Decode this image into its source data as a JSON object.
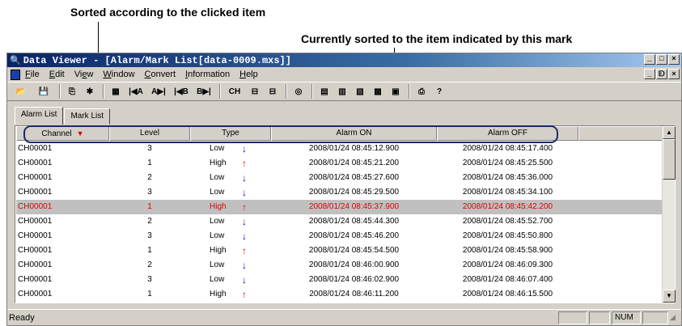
{
  "annotations": {
    "sorted_by_clicked": "Sorted according to the clicked item",
    "sort_mark": "Currently sorted to the item indicated by this mark"
  },
  "window": {
    "title": "Data Viewer - [Alarm/Mark List[data-0009.mxs]]",
    "min": "_",
    "max": "□",
    "close": "×",
    "restore": "ᗟ"
  },
  "menu": {
    "items": [
      {
        "pre": "",
        "u": "F",
        "post": "ile"
      },
      {
        "pre": "",
        "u": "E",
        "post": "dit"
      },
      {
        "pre": "Vi",
        "u": "e",
        "post": "w"
      },
      {
        "pre": "",
        "u": "W",
        "post": "indow"
      },
      {
        "pre": "",
        "u": "C",
        "post": "onvert"
      },
      {
        "pre": "",
        "u": "I",
        "post": "nformation"
      },
      {
        "pre": "",
        "u": "H",
        "post": "elp"
      }
    ]
  },
  "toolbar": {
    "buttons": [
      {
        "name": "open-icon",
        "glyph": "📂"
      },
      {
        "name": "save-icon",
        "glyph": "💾"
      },
      {
        "sep": true
      },
      {
        "name": "copy-icon",
        "glyph": "⎘"
      },
      {
        "name": "cursor-icon",
        "glyph": "✱"
      },
      {
        "sep": true
      },
      {
        "name": "grid-icon",
        "glyph": "▦"
      },
      {
        "name": "jump-a-left-icon",
        "glyph": "|◀A"
      },
      {
        "name": "jump-a-right-icon",
        "glyph": "A▶|"
      },
      {
        "name": "jump-b-left-icon",
        "glyph": "|◀B"
      },
      {
        "name": "jump-b-right-icon",
        "glyph": "B▶|"
      },
      {
        "sep": true
      },
      {
        "name": "channel-icon",
        "glyph": "CH"
      },
      {
        "name": "mark-icon",
        "glyph": "⊟"
      },
      {
        "name": "alarm-icon",
        "glyph": "⊟"
      },
      {
        "sep": true
      },
      {
        "name": "circle-icon",
        "glyph": "◎"
      },
      {
        "sep": true
      },
      {
        "name": "table-icon",
        "glyph": "▤"
      },
      {
        "name": "list-icon",
        "glyph": "▥"
      },
      {
        "name": "chart-icon",
        "glyph": "▧"
      },
      {
        "name": "display-icon",
        "glyph": "▩"
      },
      {
        "name": "info-icon",
        "glyph": "▣"
      },
      {
        "sep": true
      },
      {
        "name": "print-icon",
        "glyph": "⎙"
      },
      {
        "name": "help-icon",
        "glyph": "?"
      }
    ]
  },
  "tabs": [
    {
      "label": "Alarm List",
      "active": true
    },
    {
      "label": "Mark List",
      "active": false
    }
  ],
  "columns": {
    "channel": "Channel",
    "level": "Level",
    "type": "Type",
    "alarm_on": "Alarm ON",
    "alarm_off": "Alarm OFF",
    "sort_mark": "▼"
  },
  "rows": [
    {
      "channel": "CH00001",
      "level": "3",
      "type": "Low",
      "dir": "down",
      "on": "2008/01/24 08:45:12.900",
      "off": "2008/01/24 08:45:17.400",
      "selected": false
    },
    {
      "channel": "CH00001",
      "level": "1",
      "type": "High",
      "dir": "up",
      "on": "2008/01/24 08:45:21.200",
      "off": "2008/01/24 08:45:25.500",
      "selected": false
    },
    {
      "channel": "CH00001",
      "level": "2",
      "type": "Low",
      "dir": "down",
      "on": "2008/01/24 08:45:27.600",
      "off": "2008/01/24 08:45:36.000",
      "selected": false
    },
    {
      "channel": "CH00001",
      "level": "3",
      "type": "Low",
      "dir": "down",
      "on": "2008/01/24 08:45:29.500",
      "off": "2008/01/24 08:45:34.100",
      "selected": false
    },
    {
      "channel": "CH00001",
      "level": "1",
      "type": "High",
      "dir": "up",
      "on": "2008/01/24 08:45:37.900",
      "off": "2008/01/24 08:45:42.200",
      "selected": true
    },
    {
      "channel": "CH00001",
      "level": "2",
      "type": "Low",
      "dir": "down",
      "on": "2008/01/24 08:45:44.300",
      "off": "2008/01/24 08:45:52.700",
      "selected": false
    },
    {
      "channel": "CH00001",
      "level": "3",
      "type": "Low",
      "dir": "down",
      "on": "2008/01/24 08:45:46.200",
      "off": "2008/01/24 08:45:50.800",
      "selected": false
    },
    {
      "channel": "CH00001",
      "level": "1",
      "type": "High",
      "dir": "up",
      "on": "2008/01/24 08:45:54.500",
      "off": "2008/01/24 08:45:58.900",
      "selected": false
    },
    {
      "channel": "CH00001",
      "level": "2",
      "type": "Low",
      "dir": "down",
      "on": "2008/01/24 08:46:00.900",
      "off": "2008/01/24 08:46:09.300",
      "selected": false
    },
    {
      "channel": "CH00001",
      "level": "3",
      "type": "Low",
      "dir": "down",
      "on": "2008/01/24 08:46:02.900",
      "off": "2008/01/24 08:46:07.400",
      "selected": false
    },
    {
      "channel": "CH00001",
      "level": "1",
      "type": "High",
      "dir": "up",
      "on": "2008/01/24 08:46:11.200",
      "off": "2008/01/24 08:46:15.500",
      "selected": false
    }
  ],
  "scroll": {
    "up": "▲",
    "down": "▼"
  },
  "status": {
    "text": "Ready",
    "num": "NUM"
  },
  "colors": {
    "title_start": "#0a246a",
    "selected_text": "#e00000",
    "high_arrow": "#e00000",
    "low_arrow": "#0000cc"
  }
}
